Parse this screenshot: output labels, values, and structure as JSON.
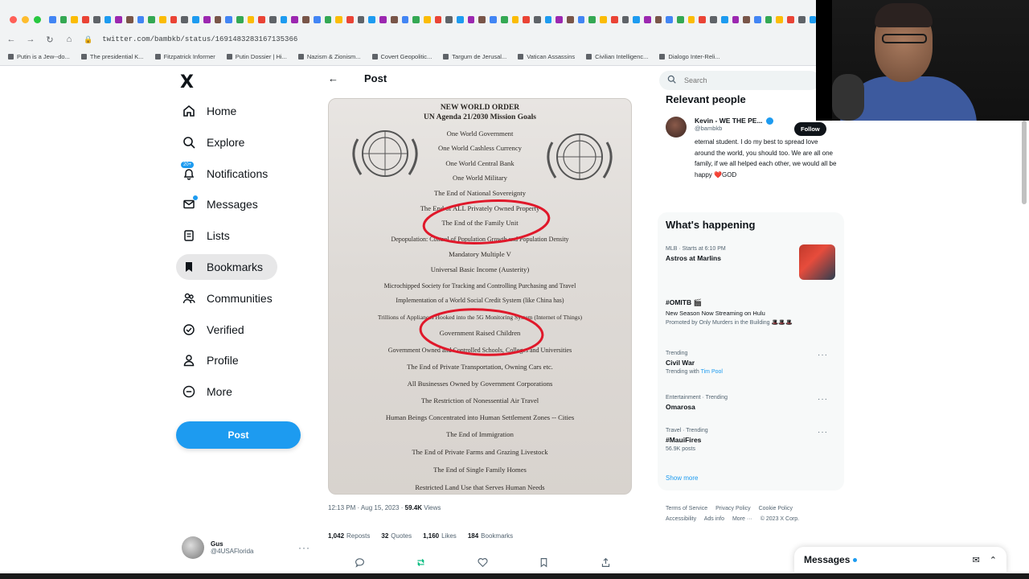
{
  "browser": {
    "url": "twitter.com/bambkb/status/1691483283167135366",
    "bookmarks": [
      "Putin is a Jew--do...",
      "The presidential K...",
      "Fitzpatrick Informer",
      "Putin Dossier | Hi...",
      "Nazism & Zionism...",
      "Covert Geopolitic...",
      "Targum de Jerusal...",
      "Vatican Assassins",
      "Civilian Intelligenc...",
      "Dialogo Inter-Reli..."
    ]
  },
  "sidebar": {
    "logo": "X",
    "items": [
      {
        "label": "Home",
        "icon": "home-icon"
      },
      {
        "label": "Explore",
        "icon": "search-icon"
      },
      {
        "label": "Notifications",
        "icon": "bell-icon",
        "badge": "20+"
      },
      {
        "label": "Messages",
        "icon": "mail-icon"
      },
      {
        "label": "Lists",
        "icon": "list-icon"
      },
      {
        "label": "Bookmarks",
        "icon": "bookmark-icon",
        "active": true
      },
      {
        "label": "Communities",
        "icon": "people-icon"
      },
      {
        "label": "Verified",
        "icon": "verified-icon"
      },
      {
        "label": "Profile",
        "icon": "person-icon"
      },
      {
        "label": "More",
        "icon": "more-circle-icon"
      }
    ],
    "post_button": "Post",
    "account": {
      "name": "Gus",
      "handle": "@4USAFlorida",
      "more": "···"
    }
  },
  "post": {
    "back": "←",
    "title": "Post",
    "document": {
      "heading1": "NEW WORLD ORDER",
      "heading2": "UN Agenda 21/2030 Mission Goals",
      "lines": [
        "One World Government",
        "One World Cashless Currency",
        "One World Central Bank",
        "One World Military",
        "The End of National Sovereignty",
        "The End of ALL Privately Owned Property",
        "The End of the Family Unit",
        "Depopulation: Control of Population Growth and Population Density",
        "Mandatory Multiple V",
        "Universal Basic Income (Austerity)",
        "Microchipped Society for Tracking and Controlling Purchasing and Travel",
        "Implementation of a World Social Credit System (like China has)",
        "Trillions of Appliances Hooked into the 5G Monitoring System (Internet of Things)",
        "Government Raised Children",
        "Government Owned and Controlled Schools, Colleges and Universities",
        "The End of Private Transportation, Owning Cars etc.",
        "All Businesses Owned by Government Corporations",
        "The Restriction of Nonessential Air Travel",
        "Human Beings Concentrated into Human Settlement Zones -- Cities",
        "The End of Immigration",
        "The End of Private Farms and Grazing Livestock",
        "The End of Single Family Homes",
        "Restricted Land Use that Serves Human Needs"
      ]
    },
    "timestamp": "12:13 PM · Aug 15, 2023 · ",
    "views_count": "59.4K",
    "views_label": " Views",
    "stats": [
      {
        "count": "1,042",
        "label": "Reposts"
      },
      {
        "count": "32",
        "label": "Quotes"
      },
      {
        "count": "1,160",
        "label": "Likes"
      },
      {
        "count": "184",
        "label": "Bookmarks"
      }
    ]
  },
  "right": {
    "search_placeholder": "Search",
    "relevant_title": "Relevant people",
    "person": {
      "name": "Kevin - WE THE PE...",
      "handle": "@bambkb",
      "bio": "eternal student. I do my best to spread love around the world, you should too. We are all one family, if we all helped each other, we would all be happy ❤️GOD",
      "follow": "Follow"
    },
    "happening_title": "What's happening",
    "trends": [
      {
        "meta": "MLB · Starts at 6:10 PM",
        "topic": "Astros at Marlins",
        "sub": ""
      },
      {
        "meta": "",
        "topic": "#OMITB 🎬",
        "sub": "New Season Now Streaming on Hulu",
        "promo": "Promoted by Only Murders in the Building 🎩🎩🎩"
      },
      {
        "meta": "Trending",
        "topic": "Civil War",
        "sub": "Trending with ",
        "link": "Tim Pool"
      },
      {
        "meta": "Entertainment · Trending",
        "topic": "Omarosa",
        "sub": ""
      },
      {
        "meta": "Travel · Trending",
        "topic": "#MauiFires",
        "sub": "56.9K posts"
      }
    ],
    "show_more": "Show more",
    "footer": [
      "Terms of Service",
      "Privacy Policy",
      "Cookie Policy",
      "Accessibility",
      "Ads info",
      "More ···",
      "© 2023 X Corp."
    ]
  },
  "dock": {
    "title": "Messages"
  }
}
